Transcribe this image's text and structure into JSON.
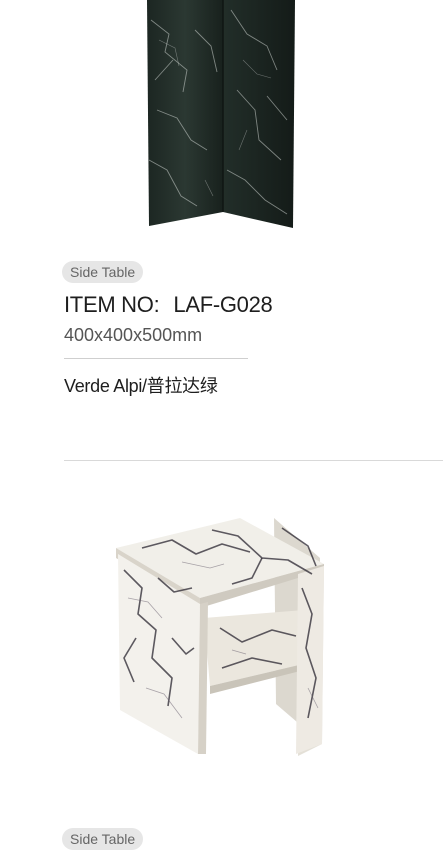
{
  "products": [
    {
      "tag": "Side Table",
      "item_label": "ITEM NO:",
      "item_code": "LAF-G028",
      "dimensions": "400x400x500mm",
      "material": "Verde Alpi/普拉达绿",
      "image_name": "verde-alpi-marble-side-table"
    },
    {
      "tag": "Side Table",
      "image_name": "calacatta-viola-marble-side-table"
    }
  ],
  "colors": {
    "tag_bg": "#e6e6e6",
    "tag_text": "#666666",
    "green_marble": "#1f2b26",
    "white_marble": "#efece4"
  }
}
